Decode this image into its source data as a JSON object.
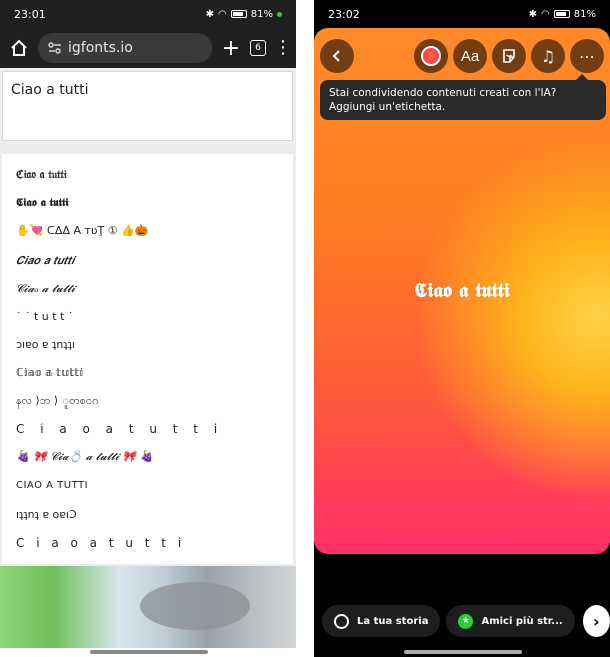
{
  "left": {
    "status": {
      "time": "23:01",
      "battery": "81%"
    },
    "browser": {
      "url": "igfonts.io",
      "tab_count": "6"
    },
    "input_text": "Ciao a tutti",
    "results": [
      "ℭ𝔦𝔞𝔬 𝔞 𝔱𝔲𝔱𝔱𝔦",
      "𝕮𝖎𝖆𝖔 𝖆 𝖙𝖚𝖙𝖙𝖎",
      "✋💘  ᑕΔΔ A тʋŢ ①  👍🎃",
      "𝑪𝒊𝒂𝒐 𝒂 𝒕𝒖𝒕𝒕𝒊",
      "𝓒𝓲𝓪ₒ 𝓪 𝓽𝓾𝓽𝓽𝓲",
      "˙  ˙                       t    u    t    t    ˙",
      "ɔıɐo ɐ ʇnʇʇı",
      "ℂ𝕚𝕒𝕠 𝕒 𝕥𝕦𝕥𝕥𝕚",
      "နလ ⟩ဘ ⟩ ူတစငဂ",
      "C i a o a t u t t i",
      "🍇  🎀  𝓒𝓲𝓪💍  𝓪 𝓽𝓾𝓽𝓽𝓲  🎀  🍇",
      "CIAO A TUTTI",
      "ıʇʇnʇ ɐ oɐıƆ",
      "C  i  a  o  a  t  u  t  t  i"
    ]
  },
  "right": {
    "status": {
      "time": "23:02",
      "battery": "81%"
    },
    "tools": {
      "text_label": "Aa"
    },
    "tooltip": {
      "line1": "Stai condividendo contenuti creati con l'IA?",
      "line2": "Aggiungi un'etichetta."
    },
    "story_text": "𝕮𝖎𝖆𝖔 𝖆 𝖙𝖚𝖙𝖙𝖎",
    "share": {
      "your_story": "La tua storia",
      "close_friends": "Amici più str..."
    }
  },
  "colors": {
    "browser_bar": "#1f1f1f",
    "story_top": "#ff8a2a",
    "story_bottom": "#ff2f6a",
    "story_glow": "#ffd24a",
    "close_friends_green": "#2ecc40"
  },
  "icons": [
    "home-icon",
    "tune-icon",
    "plus-icon",
    "tabs-icon",
    "overflow-menu-icon",
    "back-icon",
    "text-tool-icon",
    "sticker-icon",
    "music-icon",
    "more-icon",
    "chevron-right-icon",
    "star-icon"
  ]
}
